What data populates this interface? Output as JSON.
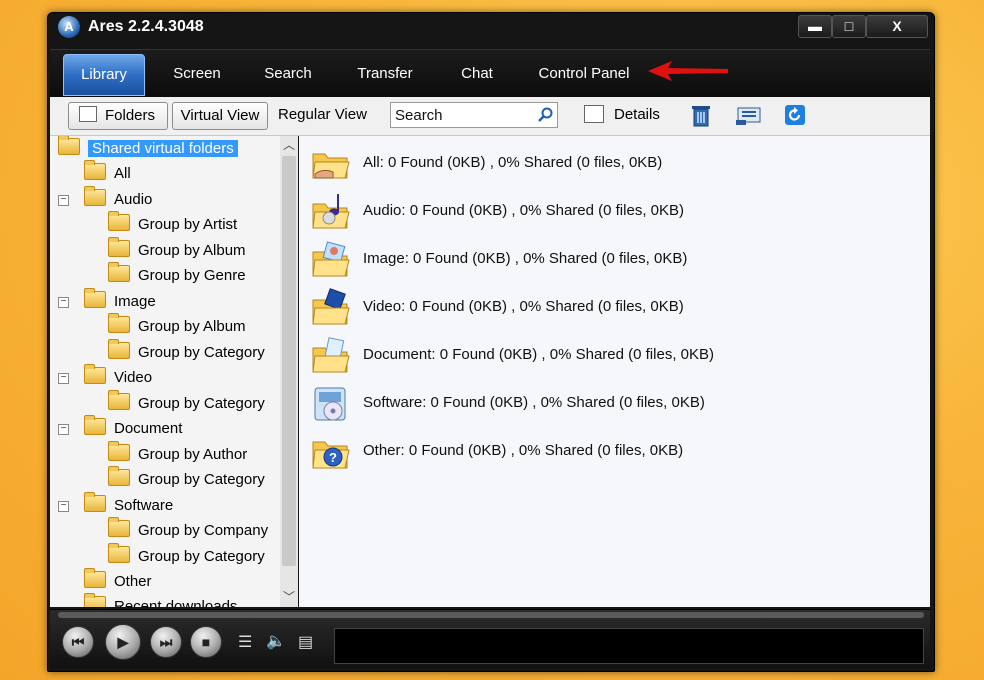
{
  "window": {
    "title": "Ares 2.2.4.3048",
    "logo_letter": "A"
  },
  "window_controls": {
    "minimize": "▬",
    "maximize": "□",
    "close": "X"
  },
  "tabs": [
    {
      "label": "Library",
      "active": true
    },
    {
      "label": "Screen"
    },
    {
      "label": "Search"
    },
    {
      "label": "Transfer"
    },
    {
      "label": "Chat"
    },
    {
      "label": "Control Panel"
    }
  ],
  "toolbar": {
    "folders": "Folders",
    "virtual_view": "Virtual View",
    "regular_view": "Regular View",
    "search_value": "Search",
    "details": "Details"
  },
  "tree": {
    "root": "Shared virtual folders",
    "items": [
      "All",
      "Audio",
      "Group by Artist",
      "Group by Album",
      "Group by Genre",
      "Image",
      "Group by Album",
      "Group by Category",
      "Video",
      "Group by Category",
      "Document",
      "Group by Author",
      "Group by Category",
      "Software",
      "Group by Company",
      "Group by Category",
      "Other",
      "Recent downloads"
    ]
  },
  "categories": [
    {
      "text": "All: 0 Found (0KB) , 0% Shared (0 files, 0KB)",
      "icon": "shared-folder-icon"
    },
    {
      "text": "Audio: 0 Found (0KB) , 0% Shared (0 files, 0KB)",
      "icon": "audio-folder-icon"
    },
    {
      "text": "Image: 0 Found (0KB) , 0% Shared (0 files, 0KB)",
      "icon": "image-folder-icon"
    },
    {
      "text": "Video: 0 Found (0KB) , 0% Shared (0 files, 0KB)",
      "icon": "video-folder-icon"
    },
    {
      "text": "Document: 0 Found (0KB) , 0% Shared (0 files, 0KB)",
      "icon": "document-folder-icon"
    },
    {
      "text": "Software: 0 Found (0KB) , 0% Shared (0 files, 0KB)",
      "icon": "software-icon"
    },
    {
      "text": "Other: 0 Found (0KB) , 0% Shared (0 files, 0KB)",
      "icon": "other-folder-icon"
    }
  ],
  "player": {
    "prev": "⏮",
    "play": "▶",
    "next": "⏭",
    "stop": "■",
    "playlist": "☰",
    "volume": "🔈",
    "options": "▤"
  },
  "colors": {
    "accent": "#2d6ec4",
    "selection": "#3399ff",
    "annotation_arrow": "#e01010"
  }
}
